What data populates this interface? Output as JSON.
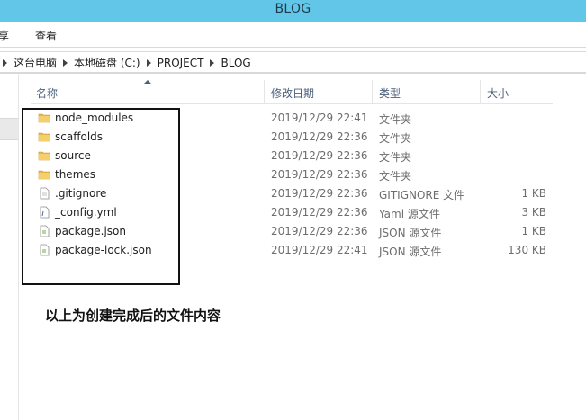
{
  "window": {
    "title": "BLOG"
  },
  "ribbon": {
    "tabs": [
      {
        "label": "享"
      },
      {
        "label": "查看"
      }
    ]
  },
  "address": {
    "crumbs": [
      "这台电脑",
      "本地磁盘 (C:)",
      "PROJECT",
      "BLOG"
    ]
  },
  "columns": {
    "name": "名称",
    "date": "修改日期",
    "type": "类型",
    "size": "大小"
  },
  "files": [
    {
      "name": "node_modules",
      "date": "2019/12/29 22:41",
      "type": "文件夹",
      "size": "",
      "icon": "folder-icon"
    },
    {
      "name": "scaffolds",
      "date": "2019/12/29 22:36",
      "type": "文件夹",
      "size": "",
      "icon": "folder-icon"
    },
    {
      "name": "source",
      "date": "2019/12/29 22:36",
      "type": "文件夹",
      "size": "",
      "icon": "folder-icon"
    },
    {
      "name": "themes",
      "date": "2019/12/29 22:36",
      "type": "文件夹",
      "size": "",
      "icon": "folder-icon"
    },
    {
      "name": ".gitignore",
      "date": "2019/12/29 22:36",
      "type": "GITIGNORE 文件",
      "size": "1 KB",
      "icon": "file-icon"
    },
    {
      "name": "_config.yml",
      "date": "2019/12/29 22:36",
      "type": "Yaml 源文件",
      "size": "3 KB",
      "icon": "yaml-file-icon"
    },
    {
      "name": "package.json",
      "date": "2019/12/29 22:36",
      "type": "JSON 源文件",
      "size": "1 KB",
      "icon": "json-file-icon"
    },
    {
      "name": "package-lock.json",
      "date": "2019/12/29 22:41",
      "type": "JSON 源文件",
      "size": "130 KB",
      "icon": "json-file-icon"
    }
  ],
  "caption": "以上为创建完成后的文件内容",
  "colors": {
    "titlebar": "#62c6e8",
    "header_text": "#4c607a",
    "folder": "#e8b84a"
  }
}
